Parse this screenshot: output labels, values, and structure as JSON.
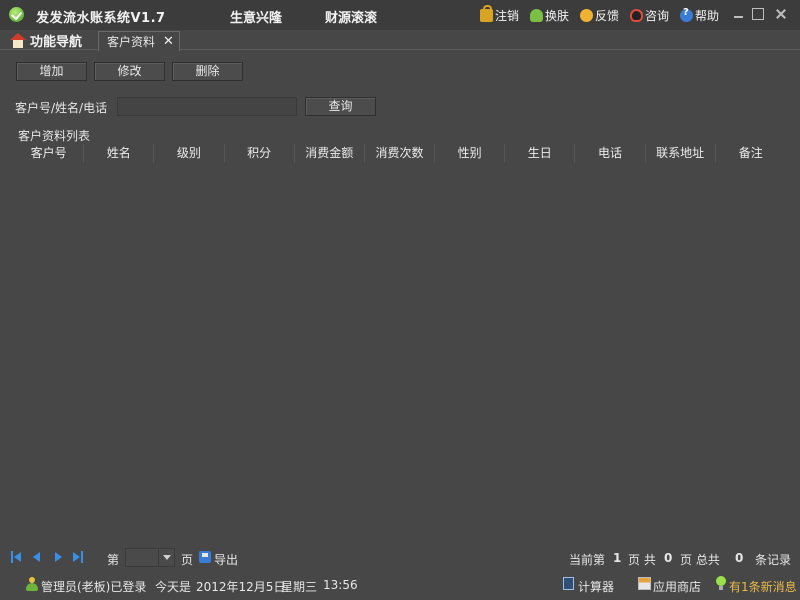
{
  "app": {
    "title": "发发流水账系统V1.7",
    "slogan_left": "生意兴隆",
    "slogan_right": "财源滚滚"
  },
  "top_menu": {
    "logout": "注销",
    "skin": "换肤",
    "feedback": "反馈",
    "consult": "咨询",
    "help": "帮助"
  },
  "tabs": {
    "home": "功能导航",
    "customer": "客户资料"
  },
  "toolbar": {
    "add": "增加",
    "edit": "修改",
    "delete": "删除"
  },
  "search": {
    "label": "客户号/姓名/电话",
    "value": "",
    "button": "查询"
  },
  "grid": {
    "title": "客户资料列表",
    "columns": [
      "客户号",
      "姓名",
      "级别",
      "积分",
      "消费金额",
      "消费次数",
      "性别",
      "生日",
      "电话",
      "联系地址",
      "备注"
    ],
    "rows": []
  },
  "pager": {
    "page_prefix": "第",
    "page_suffix": "页",
    "page_value": "",
    "export": "导出",
    "current_label": "当前第",
    "current_page": "1",
    "page_word": "页 共",
    "total_pages": "0",
    "total_label": "页 总共",
    "total_records": "0",
    "records_label": "条记录"
  },
  "status": {
    "user": "管理员(老板)已登录",
    "today_label": "今天是",
    "date": "2012年12月5日",
    "weekday": "星期三",
    "time": "13:56",
    "calculator": "计算器",
    "app_store": "应用商店",
    "new_message": "有1条新消息"
  },
  "colors": {
    "background": "#474747",
    "titlebar": "#3c3c3c",
    "nav_blue": "#3a8ee6",
    "message_orange": "#e9b94a"
  }
}
